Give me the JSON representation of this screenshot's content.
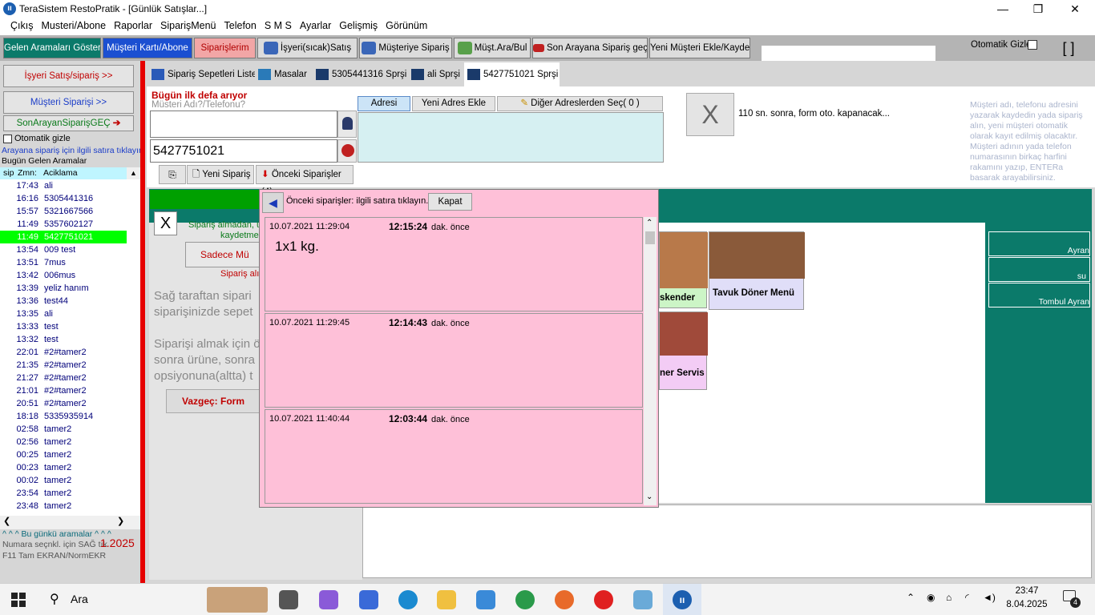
{
  "window": {
    "title": "TeraSistem RestoPratik - [Günlük Satışlar...]",
    "minimize": "—",
    "restore": "❐",
    "close": "✕"
  },
  "menu": [
    "Çıkış",
    "Musteri/Abone",
    "Raporlar",
    "SiparişMenü",
    "Telefon",
    "S M S",
    "Ayarlar",
    "Gelişmiş",
    "Görünüm"
  ],
  "toolbar": {
    "gelen": "Gelen Aramaları Göster",
    "musteri_karti": "Müşteri Kartı/Abone",
    "siparislerim": "Siparişlerim",
    "isyeri": "İşyeri(sıcak)Satış",
    "musteriye": "Müşteriye Sipariş",
    "must_ara": "Müşt.Ara/Bul",
    "son_arayana": "Son Arayana Sipariş geç",
    "yeni_musteri": "Yeni Müşteri Ekle/Kaydet",
    "otomatik_gizle": "Otomatik Gizle",
    "brackets": "[ ]"
  },
  "left": {
    "isyeri_btn": "İşyeri Satış/sipariş >>",
    "musteri_btn": "Müşteri Siparişi >>",
    "son_arayan_btn": "SonArayanSiparişGEÇ",
    "otomatik_gizle": "Otomatik gizle",
    "hint": "Arayana sipariş için ilgili satıra tıklayın",
    "bugun_gelen": "Bugün Gelen Aramalar",
    "col_sip": "sip",
    "col_zmn": "Zmn:",
    "col_aciklama": "Aciklama",
    "calls": [
      {
        "time": "17:43",
        "name": "ali"
      },
      {
        "time": "16:16",
        "name": "5305441316"
      },
      {
        "time": "15:57",
        "name": "5321667566"
      },
      {
        "time": "11:49",
        "name": "5357602127"
      },
      {
        "time": "11:49",
        "name": "5427751021",
        "selected": true
      },
      {
        "time": "13:54",
        "name": "009 test"
      },
      {
        "time": "13:51",
        "name": "7mus"
      },
      {
        "time": "13:42",
        "name": "006mus"
      },
      {
        "time": "13:39",
        "name": "yeliz hanım"
      },
      {
        "time": "13:36",
        "name": "test44"
      },
      {
        "time": "13:35",
        "name": "ali"
      },
      {
        "time": "13:33",
        "name": "test"
      },
      {
        "time": "13:32",
        "name": "test"
      },
      {
        "time": "22:01",
        "name": "#2#tamer2"
      },
      {
        "time": "21:35",
        "name": "#2#tamer2"
      },
      {
        "time": "21:27",
        "name": "#2#tamer2"
      },
      {
        "time": "21:01",
        "name": "#2#tamer2"
      },
      {
        "time": "20:51",
        "name": "#2#tamer2"
      },
      {
        "time": "18:18",
        "name": "5335935914"
      },
      {
        "time": "02:58",
        "name": "tamer2"
      },
      {
        "time": "02:56",
        "name": "tamer2"
      },
      {
        "time": "00:25",
        "name": "tamer2"
      },
      {
        "time": "00:23",
        "name": "tamer2"
      },
      {
        "time": "00:02",
        "name": "tamer2"
      },
      {
        "time": "23:54",
        "name": "tamer2"
      },
      {
        "time": "23:48",
        "name": "tamer2"
      }
    ],
    "footer_bugun": "^ ^ ^ Bu günkü aramalar ^ ^ ^",
    "footer_numara": "Numara seçnkl. için SAĞ tık",
    "footer_f11": "F11 Tam EKRAN/NormEKR",
    "footer_version": "1.2025"
  },
  "tabs": [
    "Sipariş Sepetleri Liste",
    "Masalar",
    "5305441316 Sprşi",
    "ali Sprşi",
    "5427751021 Sprşi"
  ],
  "customer": {
    "bugun_ilk": "Bügün ilk defa arıyor",
    "placeholder": "Müsteri Adı?/Telefonu?",
    "name_value": "",
    "phone_value": "5427751021",
    "adres_tab": "Adresi",
    "yeni_adres": "Yeni Adres Ekle",
    "diger_adres": "Diğer Adreslerden Seç( 0 )",
    "yeni_siparis": "Yeni Sipariş",
    "onceki_siparisler": "Önceki Siparişler (4)",
    "close_x": "X",
    "timer_text": "110 sn. sonra, form oto. kapanacak...",
    "help": "Müşteri adı, telefonu adresini yazarak kaydedin yada sipariş alın, yeni müşteri otomatik olarak kayıt edilmiş olacaktır. Müşteri adının yada telefon numarasının birkaç harfini rakamını yazıp, ENTERa basarak arayabilirsiniz."
  },
  "background_order": {
    "x": "X",
    "siparis_almadan": "Sipariş almadan, ü",
    "kaydetme": "kaydetme",
    "sadece_btn": "Sadece Mü",
    "siparis_al": "Sipariş alı",
    "text1a": "Sağ taraftan sipari",
    "text1b": "siparişinizde sepet",
    "text2a": "Siparişi almak için ö",
    "text2b": "sonra ürüne, sonra",
    "text2c": "opsiyonuna(altta) t",
    "vazgec_btn": "Vazgeç: Form"
  },
  "products": {
    "iskender": "skender",
    "tavuk": "Tavuk Döner Menü",
    "servis": "ner Servis"
  },
  "drinks": [
    "Ayran",
    "su",
    "Tombul Ayran"
  ],
  "popup": {
    "header": "Önceki siparişler: ilgili satıra tıklayın...",
    "kapat": "Kapat",
    "ago_label": "dak. önce",
    "orders": [
      {
        "date": "10.07.2021 11:29:04",
        "elapsed": "12:15:24",
        "content": "1x1 kg."
      },
      {
        "date": "10.07.2021 11:29:45",
        "elapsed": "12:14:43",
        "content": ""
      },
      {
        "date": "10.07.2021 11:40:44",
        "elapsed": "12:03:44",
        "content": ""
      }
    ]
  },
  "taskbar": {
    "search": "Ara",
    "time": "23:47",
    "date": "8.04.2025",
    "notif": "4"
  }
}
